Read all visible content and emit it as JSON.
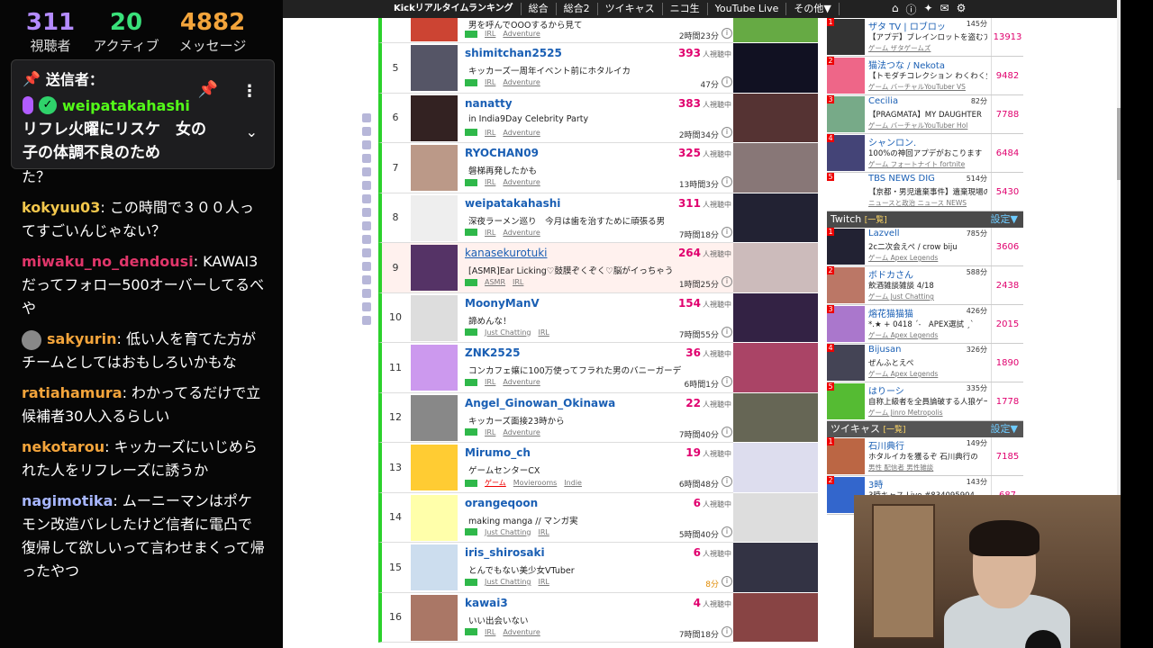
{
  "chat": {
    "stats": [
      {
        "value": "311",
        "label": "視聴者"
      },
      {
        "value": "20",
        "label": "アクティブ"
      },
      {
        "value": "4882",
        "label": "メッセージ"
      }
    ],
    "pinned": {
      "header": "送信者：",
      "user": "weipatakahashi",
      "text": "リフレ火曜にリスケ　女の子の体調不良のため"
    },
    "messages": [
      {
        "user": "",
        "text": "た？",
        "color": "#ffffff"
      },
      {
        "user": "kokyuu03",
        "text": "この時間で３００人ってすごいんじゃない？",
        "color": "#f3c74c"
      },
      {
        "user": "miwaku_no_dendousi",
        "text": "KAWAI3だってフォロー500オーバーしてるべや",
        "color": "#e0366a"
      },
      {
        "user": "sakyurin",
        "text": "低い人を育てた方がチームとしてはおもしろいかもな",
        "color": "#f3a43b"
      },
      {
        "user": "ratiahamura",
        "text": "わかってるだけで立候補者30人入るらしい",
        "color": "#f3a43b"
      },
      {
        "user": "nekotarou",
        "text": "キッカーズにいじめられた人をリフレーズに誘うか",
        "color": "#f3a43b"
      },
      {
        "user": "nagimotika",
        "text": "ムーニーマンはポケモン改造バレしたけど信者に電凸で復帰して欲しいって言わせまくって帰ったやつ",
        "color": "#a7b6ff"
      }
    ]
  },
  "topnav": {
    "items": [
      "Kickリアルタイムランキング",
      "総合",
      "総合2",
      "ツイキャス",
      "ニコ生",
      "YouTube Live",
      "その他▼"
    ],
    "icons": [
      "home-icon",
      "info-icon",
      "twitter-icon",
      "mail-icon",
      "gear-icon"
    ]
  },
  "ranking": {
    "viewer_unit": "人視聴中",
    "rows": [
      {
        "rank": "",
        "name": "",
        "viewers": "",
        "desc": "男を呼んでOOOするから見て",
        "tags": [
          "IRL",
          "Adventure"
        ],
        "time": "2時間23分"
      },
      {
        "rank": "5",
        "name": "shimitchan2525",
        "viewers": "393",
        "desc": "キッカーズ一周年イベント前にホタルイカ",
        "tags": [
          "IRL",
          "Adventure"
        ],
        "time": "47分"
      },
      {
        "rank": "6",
        "name": "nanatty",
        "viewers": "383",
        "desc": "in India9Day Celebrity Party",
        "tags": [
          "IRL",
          "Adventure"
        ],
        "time": "2時間34分"
      },
      {
        "rank": "7",
        "name": "RYOCHAN09",
        "viewers": "325",
        "desc": "磐梯再発したかも",
        "tags": [
          "IRL",
          "Adventure"
        ],
        "time": "13時間3分"
      },
      {
        "rank": "8",
        "name": "weipatakahashi",
        "viewers": "311",
        "desc": "深夜ラーメン巡り　今月は歯を治すために頑張る男",
        "tags": [
          "IRL",
          "Adventure"
        ],
        "time": "7時間18分"
      },
      {
        "rank": "9",
        "name": "kanasekurotuki",
        "viewers": "264",
        "desc": "[ASMR]Ear Licking♡鼓膜ぞくぞく♡脳がイっちゃう",
        "tags": [
          "ASMR",
          "IRL"
        ],
        "time": "1時間25分"
      },
      {
        "rank": "10",
        "name": "MoonyManV",
        "viewers": "154",
        "desc": "諦めんな！",
        "tags": [
          "Just Chatting",
          "IRL"
        ],
        "time": "7時間55分"
      },
      {
        "rank": "11",
        "name": "ZNK2525",
        "viewers": "36",
        "desc": "コンカフェ嬢に100万使ってフラれた男のバニーガーデ",
        "tags": [
          "IRL",
          "Adventure"
        ],
        "time": "6時間1分"
      },
      {
        "rank": "12",
        "name": "Angel_Ginowan_Okinawa",
        "viewers": "22",
        "desc": "キッカーズ面接23時から",
        "tags": [
          "IRL",
          "Adventure"
        ],
        "time": "7時間40分"
      },
      {
        "rank": "13",
        "name": "Mirumo_ch",
        "viewers": "19",
        "desc": "ゲームセンターCX",
        "tags": [
          "ゲーム",
          "Movierooms",
          "Indie"
        ],
        "time": "6時間48分"
      },
      {
        "rank": "14",
        "name": "orangeqoon",
        "viewers": "6",
        "desc": "making manga // マンガ実",
        "tags": [
          "Just Chatting",
          "IRL"
        ],
        "time": "5時間40分"
      },
      {
        "rank": "15",
        "name": "iris_shirosaki",
        "viewers": "6",
        "desc": "とんでもない美少女VTuber",
        "tags": [
          "Just Chatting",
          "IRL"
        ],
        "time": "8分"
      },
      {
        "rank": "16",
        "name": "kawai3",
        "viewers": "4",
        "desc": "いい出会いない",
        "tags": [
          "IRL",
          "Adventure"
        ],
        "time": "7時間18分"
      }
    ]
  },
  "youtube": {
    "rows": [
      {
        "name": "ザタ TV | ロブロッ",
        "minutes": "145分",
        "desc": "【アプデ】ブレインロットを盗むア",
        "tags": "ゲーム ザタゲームズ",
        "viewers": "13913"
      },
      {
        "name": "猫法つな / Nekota",
        "minutes": "",
        "desc": "【トモダチコレクション わくわく生",
        "tags": "ゲーム バーチャルYouTuber VS",
        "viewers": "9482"
      },
      {
        "name": "Cecilia",
        "minutes": "82分",
        "desc": "【PRAGMATA】MY DAUGHTER",
        "tags": "ゲーム バーチャルYouTuber Hol",
        "viewers": "7788"
      },
      {
        "name": "シャンロン.",
        "minutes": "",
        "desc": "100%の神回アプデがおこります",
        "tags": "ゲーム フォートナイト fortnite",
        "viewers": "6484"
      },
      {
        "name": "TBS NEWS DIG",
        "minutes": "514分",
        "desc": "【京都・男児遺棄事件】遺棄現場の",
        "tags": "ニュースと政治 ニュース NEWS",
        "viewers": "5430"
      }
    ]
  },
  "twitch": {
    "title": "Twitch",
    "sub": "[一覧]",
    "settings": "設定▼",
    "rows": [
      {
        "name": "Lazvell",
        "minutes": "785分",
        "desc": "2c二次会えぺ / crow biju",
        "tags": "ゲーム Apex Legends",
        "viewers": "3606"
      },
      {
        "name": "ボドカさん",
        "minutes": "588分",
        "desc": "飲酒雑談雑談 4/18",
        "tags": "ゲーム Just Chatting",
        "viewers": "2438"
      },
      {
        "name": "熔花猫猫猫",
        "minutes": "426分",
        "desc": "*.★ + 0418 ˊ˗　APEX選試 ˏˋ",
        "tags": "ゲーム Apex Legends",
        "viewers": "2015"
      },
      {
        "name": "Bijusan",
        "minutes": "326分",
        "desc": "ぜんふとえぺ",
        "tags": "ゲーム Apex Legends",
        "viewers": "1890"
      },
      {
        "name": "はりーシ",
        "minutes": "335分",
        "desc": "自称上級者を全員論破する人狼ゲー",
        "tags": "ゲーム Jinro Metropolis",
        "viewers": "1778"
      }
    ]
  },
  "twitcas": {
    "title": "ツイキャス",
    "sub": "[一覧]",
    "settings": "設定▼",
    "rows": [
      {
        "name": "石川典行",
        "minutes": "149分",
        "desc": "ホタルイカを獲るぞ 石川典行の",
        "tags": "男性 配信者 男性雑談",
        "viewers": "7185"
      },
      {
        "name": "3時",
        "minutes": "143分",
        "desc": "3時キャス Live #834095904",
        "tags": "",
        "viewers": "687"
      }
    ]
  },
  "colors": {
    "kick_green": "#2bd12b",
    "viewer_pink": "#e0006e",
    "link_blue": "#1a5fb4",
    "chat_bg": "#060606"
  }
}
